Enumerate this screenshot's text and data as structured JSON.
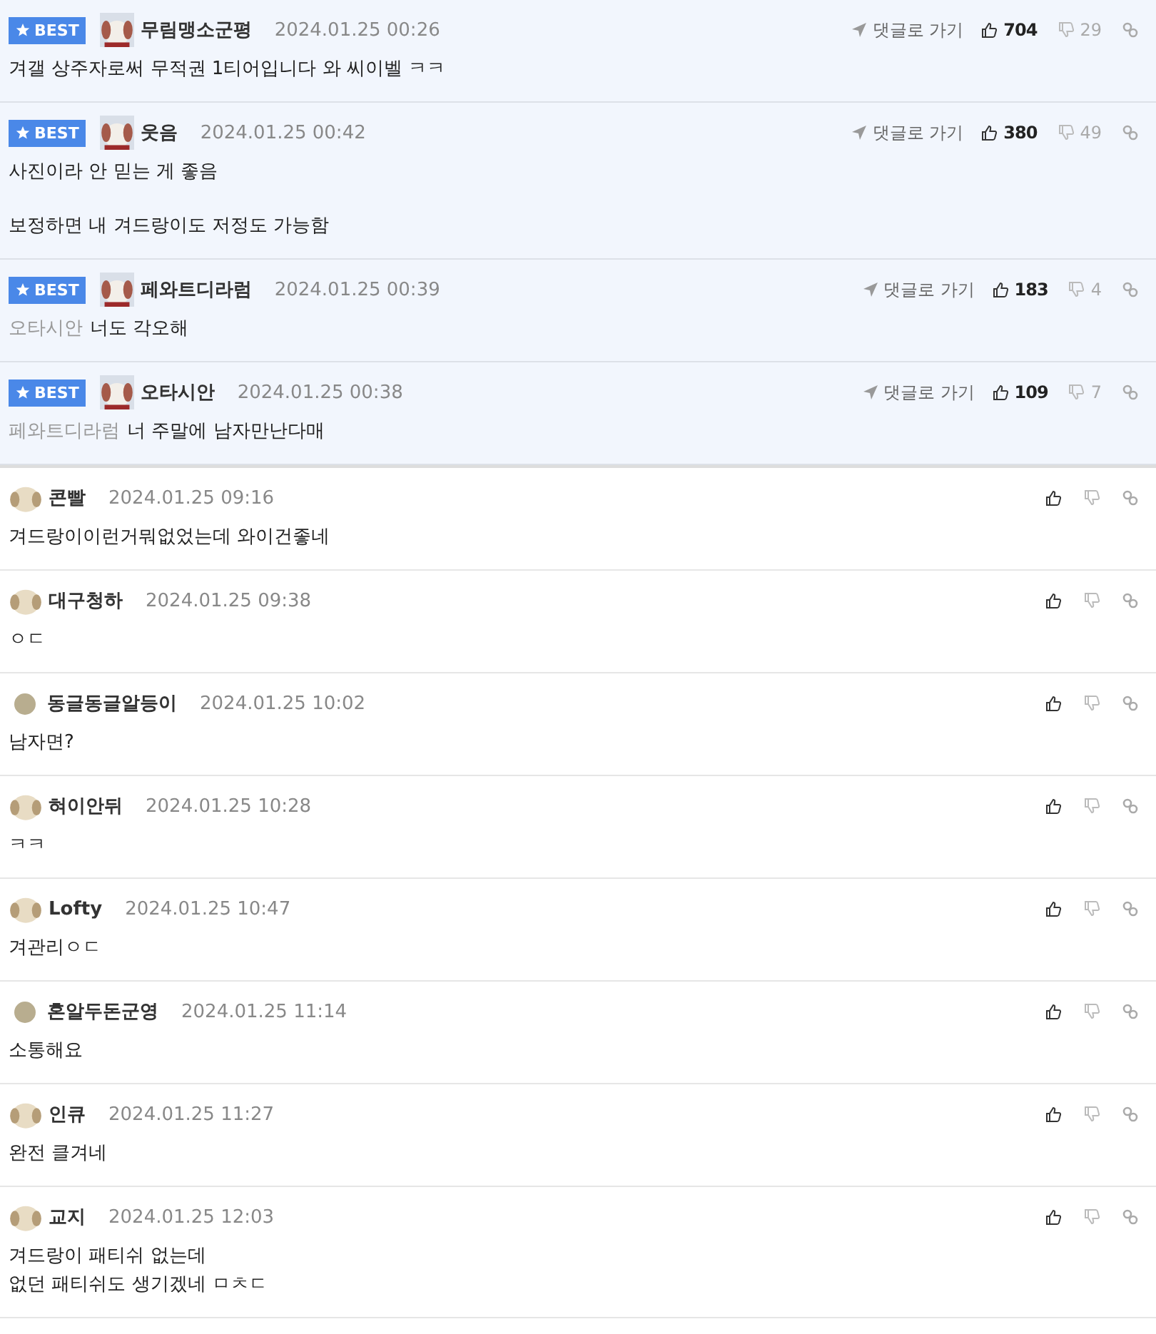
{
  "best_comments": [
    {
      "badge": "BEST",
      "author": "무림맹소군평",
      "avatar": {
        "kind": "picture"
      },
      "time": "2024.01.25 00:26",
      "goto": "댓글로 가기",
      "likes": "704",
      "dislikes": "29",
      "lines": [
        "겨갤 상주자로써 무적권 1티어입니다 와 씨이벨 ㅋㅋ"
      ]
    },
    {
      "badge": "BEST",
      "author": "웃음",
      "avatar": {
        "kind": "picture"
      },
      "time": "2024.01.25 00:42",
      "goto": "댓글로 가기",
      "likes": "380",
      "dislikes": "49",
      "lines": [
        "사진이라 안 믿는 게 좋음"
      ],
      "paragraph_2": [
        "보정하면 내 겨드랑이도 저정도 가능함"
      ]
    },
    {
      "badge": "BEST",
      "author": "페와트디라럼",
      "avatar": {
        "kind": "picture"
      },
      "time": "2024.01.25 00:39",
      "goto": "댓글로 가기",
      "likes": "183",
      "dislikes": "4",
      "reply_to": "오타시안",
      "lines": [
        "너도 각오해"
      ]
    },
    {
      "badge": "BEST",
      "author": "오타시안",
      "avatar": {
        "kind": "picture"
      },
      "time": "2024.01.25 00:38",
      "goto": "댓글로 가기",
      "likes": "109",
      "dislikes": "7",
      "reply_to": "페와트디라럼",
      "lines": [
        "너 주말에 남자만난다매"
      ]
    }
  ],
  "comments": [
    {
      "author": "콘빨",
      "avatar": {
        "kind": "picture"
      },
      "time": "2024.01.25 09:16",
      "lines": [
        "겨드랑이이런거뭐없었는데 와이건좋네"
      ]
    },
    {
      "author": "대구청하",
      "avatar": {
        "kind": "picture"
      },
      "time": "2024.01.25 09:38",
      "lines": [
        "ㅇㄷ"
      ]
    },
    {
      "author": "동글동글알등이",
      "avatar": {
        "kind": "dot",
        "color": "#b8ad8f"
      },
      "time": "2024.01.25 10:02",
      "lines": [
        "남자면?"
      ]
    },
    {
      "author": "혀이안뒤",
      "avatar": {
        "kind": "picture"
      },
      "time": "2024.01.25 10:28",
      "lines": [
        "ㅋㅋ"
      ]
    },
    {
      "author": "Lofty",
      "avatar": {
        "kind": "picture"
      },
      "time": "2024.01.25 10:47",
      "lines": [
        "겨관리ㅇㄷ"
      ]
    },
    {
      "author": "혼알두돈군영",
      "avatar": {
        "kind": "dot",
        "color": "#b8ad8f"
      },
      "time": "2024.01.25 11:14",
      "lines": [
        "소통해요"
      ]
    },
    {
      "author": "인큐",
      "avatar": {
        "kind": "picture"
      },
      "time": "2024.01.25 11:27",
      "lines": [
        "완전 클겨네"
      ]
    },
    {
      "author": "교지",
      "avatar": {
        "kind": "picture"
      },
      "time": "2024.01.25 12:03",
      "lines": [
        "겨드랑이 패티쉬 없는데",
        "없던 패티쉬도 생기겠네 ㅁㅊㄷ"
      ]
    }
  ]
}
